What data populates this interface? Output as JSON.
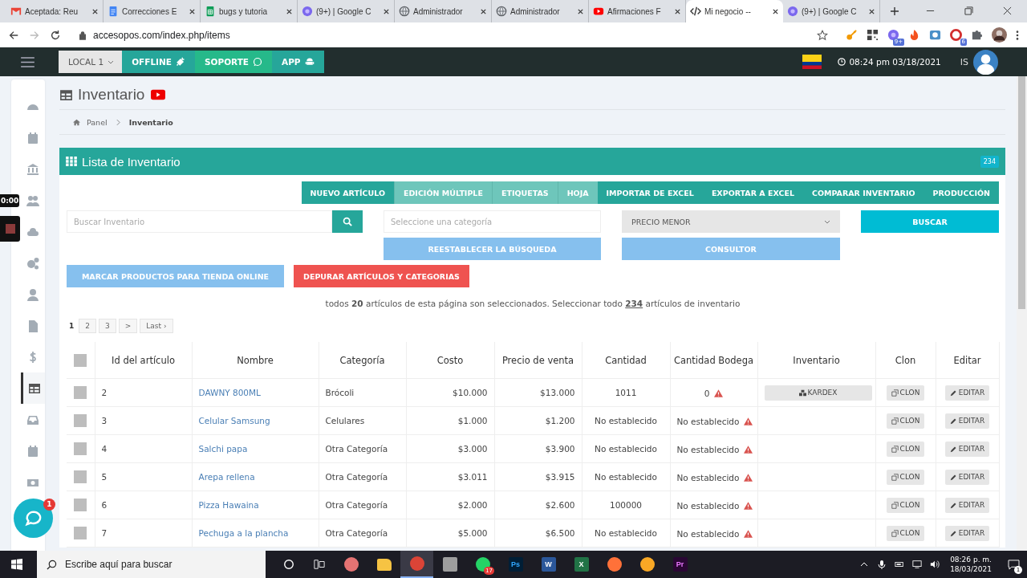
{
  "browser": {
    "tabs": [
      {
        "title": "Aceptada: Reu",
        "kind": "mail",
        "selected": false
      },
      {
        "title": "Correcciones E",
        "kind": "doc",
        "selected": false
      },
      {
        "title": "bugs y tutoria",
        "kind": "sheet",
        "selected": false
      },
      {
        "title": "(9+) | Google C",
        "kind": "flower",
        "selected": false
      },
      {
        "title": "Administrador",
        "kind": "globe",
        "selected": false
      },
      {
        "title": "Administrador",
        "kind": "globe",
        "selected": false
      },
      {
        "title": "Afirmaciones F",
        "kind": "play",
        "selected": false
      },
      {
        "title": "Mi negocio -- ",
        "kind": "code",
        "selected": true
      },
      {
        "title": "(9+) | Google C",
        "kind": "flower",
        "selected": false
      }
    ],
    "address": "accesopos.com/index.php/items",
    "extensions": [
      {
        "kind": "key"
      },
      {
        "kind": "qr"
      },
      {
        "kind": "flower",
        "badge": "9+"
      },
      {
        "kind": "fire"
      },
      {
        "kind": "camera"
      },
      {
        "kind": "red",
        "badge": "6"
      },
      {
        "kind": "puzzle"
      }
    ]
  },
  "app_header": {
    "location": "LOCAL 1",
    "buttons": [
      {
        "label": "OFFLINE",
        "kind": "plug"
      },
      {
        "label": "SOPORTE",
        "kind": "chat"
      },
      {
        "label": "APP",
        "kind": "android"
      }
    ],
    "datetime": "08:24 pm 03/18/2021",
    "user": "IS"
  },
  "sidebar": {
    "items": [
      {
        "kind": "gauge",
        "selected": false
      },
      {
        "kind": "calendar",
        "selected": false
      },
      {
        "kind": "bank",
        "selected": false
      },
      {
        "kind": "users",
        "selected": false
      },
      {
        "kind": "cloud",
        "selected": false
      },
      {
        "kind": "gears",
        "selected": false
      },
      {
        "kind": "user",
        "selected": false
      },
      {
        "kind": "file",
        "selected": false
      },
      {
        "kind": "dollar",
        "selected": false
      },
      {
        "kind": "table",
        "selected": true
      },
      {
        "kind": "inbox",
        "selected": false
      },
      {
        "kind": "calendar",
        "selected": false
      },
      {
        "kind": "money",
        "selected": false
      }
    ]
  },
  "page": {
    "title": "Inventario",
    "breadcrumb": [
      "Panel",
      "Inventario"
    ]
  },
  "panel": {
    "title": "Lista de Inventario",
    "count": "234",
    "actions": [
      {
        "label": "NUEVO ARTÍCULO",
        "kind": "dark"
      },
      {
        "label": "EDICIÓN MÚLTIPLE",
        "kind": "light"
      },
      {
        "label": "ETIQUETAS",
        "kind": "light"
      },
      {
        "label": "HOJA",
        "kind": "light"
      },
      {
        "label": "IMPORTAR DE EXCEL",
        "kind": "dark"
      },
      {
        "label": "EXPORTAR A EXCEL",
        "kind": "dark"
      },
      {
        "label": "COMPARAR INVENTARIO",
        "kind": "dark"
      },
      {
        "label": "PRODUCCIÓN",
        "kind": "dark"
      }
    ],
    "search": {
      "placeholder": "Buscar Inventario"
    },
    "category": {
      "placeholder": "Seleccione una categoría"
    },
    "sort": {
      "value": "PRECIO MENOR"
    },
    "search_button": "BUSCAR",
    "reset_button": "REESTABLECER LA BÚSQUEDA",
    "consultant_button": "CONSULTOR",
    "online_button": "MARCAR PRODUCTOS PARA TIENDA ONLINE",
    "purge_button": "DEPURAR ARTÍCULOS Y CATEGORIAS",
    "selection_note": {
      "before": "todos **20** artículos de esta página son seleccionados. Seleccionar todo",
      "link": "234",
      "after": "artículos de inventario"
    },
    "pagination": [
      {
        "label": "1",
        "selected": true
      },
      {
        "label": "2",
        "selected": false
      },
      {
        "label": "3",
        "selected": false
      },
      {
        "label": ">",
        "selected": false
      },
      {
        "label": "Last ›",
        "selected": false
      }
    ],
    "table": {
      "header_checked": false,
      "columns": [
        "Id del artículo",
        "Nombre",
        "Categoría",
        "Costo",
        "Precio de venta",
        "Cantidad",
        "Cantidad Bodega",
        "Inventario",
        "Clon",
        "Editar"
      ],
      "rows": [
        {
          "checked": false,
          "id": "2",
          "name": "DAWNY 800ML",
          "category": "Brócoli",
          "cost": "$10.000",
          "price": "$13.000",
          "quantity": "1011",
          "warehouse": "0",
          "warning": true,
          "kardex": "KARDEX",
          "clone": "CLON",
          "edit": "EDITAR"
        },
        {
          "checked": false,
          "id": "3",
          "name": "Celular Samsung",
          "category": "Celulares",
          "cost": "$1.000",
          "price": "$1.200",
          "quantity": "No establecido",
          "warehouse": "No establecido",
          "warning": true,
          "clone": "CLON",
          "edit": "EDITAR"
        },
        {
          "checked": false,
          "id": "4",
          "name": "Salchi papa",
          "category": "Otra Categoría",
          "cost": "$3.000",
          "price": "$3.900",
          "quantity": "No establecido",
          "warehouse": "No establecido",
          "warning": true,
          "clone": "CLON",
          "edit": "EDITAR"
        },
        {
          "checked": false,
          "id": "5",
          "name": "Arepa rellena",
          "category": "Otra Categoría",
          "cost": "$3.011",
          "price": "$3.915",
          "quantity": "No establecido",
          "warehouse": "No establecido",
          "warning": true,
          "clone": "CLON",
          "edit": "EDITAR"
        },
        {
          "checked": false,
          "id": "6",
          "name": "Pizza Hawaina",
          "category": "Otra Categoría",
          "cost": "$2.000",
          "price": "$2.600",
          "quantity": "100000",
          "warehouse": "No establecido",
          "warning": true,
          "clone": "CLON",
          "edit": "EDITAR"
        },
        {
          "checked": false,
          "id": "7",
          "name": "Pechuga a la plancha",
          "category": "Otra Categoría",
          "cost": "$5.000",
          "price": "$6.500",
          "quantity": "No establecido",
          "warehouse": "No establecido",
          "warning": true,
          "clone": "CLON",
          "edit": "EDITAR"
        }
      ]
    }
  },
  "recorder": {
    "time": "0:00"
  },
  "chat": {
    "badge": "1"
  },
  "taskbar": {
    "search": {
      "placeholder": "Escribe aquí para buscar"
    },
    "apps": [
      {
        "kind": "paint",
        "selected": false
      },
      {
        "kind": "folder",
        "selected": false
      },
      {
        "kind": "chrome",
        "selected": true
      },
      {
        "kind": "calc",
        "selected": false
      },
      {
        "kind": "whatsapp",
        "selected": false,
        "badge": "17"
      },
      {
        "kind": "ps",
        "label": "Ps",
        "selected": false
      },
      {
        "kind": "word",
        "label": "W",
        "selected": false
      },
      {
        "kind": "excel",
        "label": "X",
        "selected": false
      },
      {
        "kind": "firefox",
        "selected": false
      },
      {
        "kind": "vpn",
        "selected": false
      },
      {
        "kind": "premiere",
        "label": "Pr",
        "selected": false
      }
    ],
    "time": "08:26 p. m.",
    "date": "18/03/2021",
    "notifications": "1"
  }
}
